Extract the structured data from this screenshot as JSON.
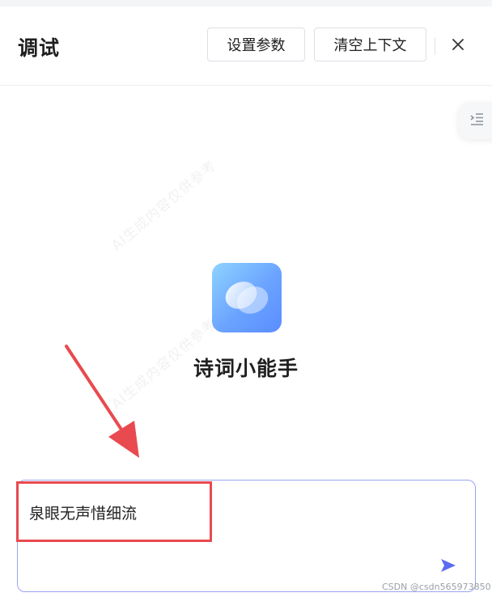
{
  "header": {
    "title": "调试",
    "set_params_label": "设置参数",
    "clear_context_label": "清空上下文",
    "close_icon": "close-icon"
  },
  "sidebar_toggle": {
    "icon": "list-indent-icon"
  },
  "watermark": {
    "text": "AI生成内容仅供参考"
  },
  "assistant": {
    "logo_icon": "app-logo-icon",
    "name": "诗词小能手"
  },
  "composer": {
    "value": "泉眼无声惜细流",
    "send_icon": "send-icon"
  },
  "annotation": {
    "color": "#e84a4f"
  },
  "footer": {
    "credit": "CSDN @csdn565973850"
  },
  "colors": {
    "accent": "#5b6cf0",
    "border": "#9aa3f0"
  }
}
